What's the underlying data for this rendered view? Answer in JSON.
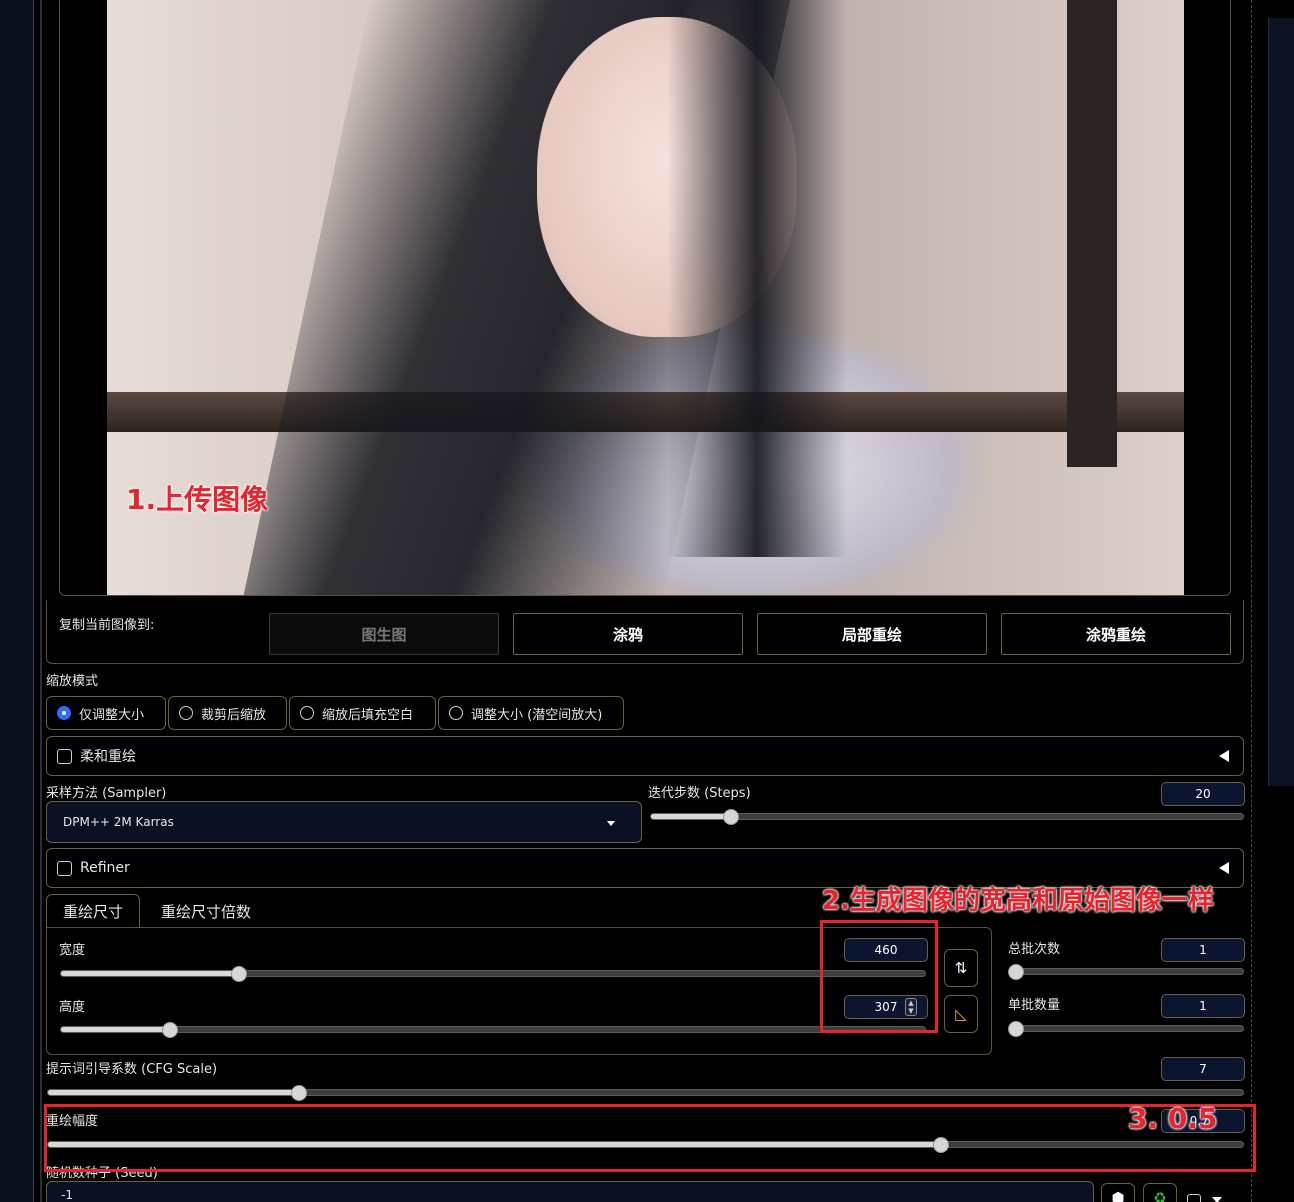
{
  "annotations": {
    "step1": "1.上传图像",
    "step2": "2.生成图像的宽高和原始图像一样",
    "step3": "3. 0.5"
  },
  "copy_to": {
    "label": "复制当前图像到:",
    "buttons": [
      "图生图",
      "涂鸦",
      "局部重绘",
      "涂鸦重绘"
    ]
  },
  "resize_mode": {
    "label": "缩放模式",
    "options": [
      "仅调整大小",
      "裁剪后缩放",
      "缩放后填充空白",
      "调整大小 (潜空间放大)"
    ],
    "selected_index": 0
  },
  "soft_inpaint": {
    "label": "柔和重绘"
  },
  "sampler": {
    "label": "采样方法 (Sampler)",
    "value": "DPM++ 2M Karras"
  },
  "steps": {
    "label": "迭代步数 (Steps)",
    "value": "20",
    "fraction": 0.13
  },
  "refiner": {
    "label": "Refiner"
  },
  "size_tabs": {
    "tabs": [
      "重绘尺寸",
      "重绘尺寸倍数"
    ],
    "active": 0
  },
  "width": {
    "label": "宽度",
    "value": "460",
    "fraction": 0.21
  },
  "height": {
    "label": "高度",
    "value": "307",
    "fraction": 0.13
  },
  "batch_count": {
    "label": "总批次数",
    "value": "1",
    "fraction": 0.0
  },
  "batch_size": {
    "label": "单批数量",
    "value": "1",
    "fraction": 0.0
  },
  "cfg_scale": {
    "label": "提示词引导系数 (CFG Scale)",
    "value": "7",
    "fraction": 0.21
  },
  "denoise": {
    "label": "重绘幅度",
    "value": "0.75",
    "fraction": 0.75
  },
  "seed": {
    "label": "随机数种子 (Seed)",
    "value": "-1"
  },
  "icons": {
    "swap": "swap-vertical-icon",
    "ratio": "aspect-ratio-icon",
    "dice": "dice-icon",
    "recycle": "recycle-icon"
  }
}
